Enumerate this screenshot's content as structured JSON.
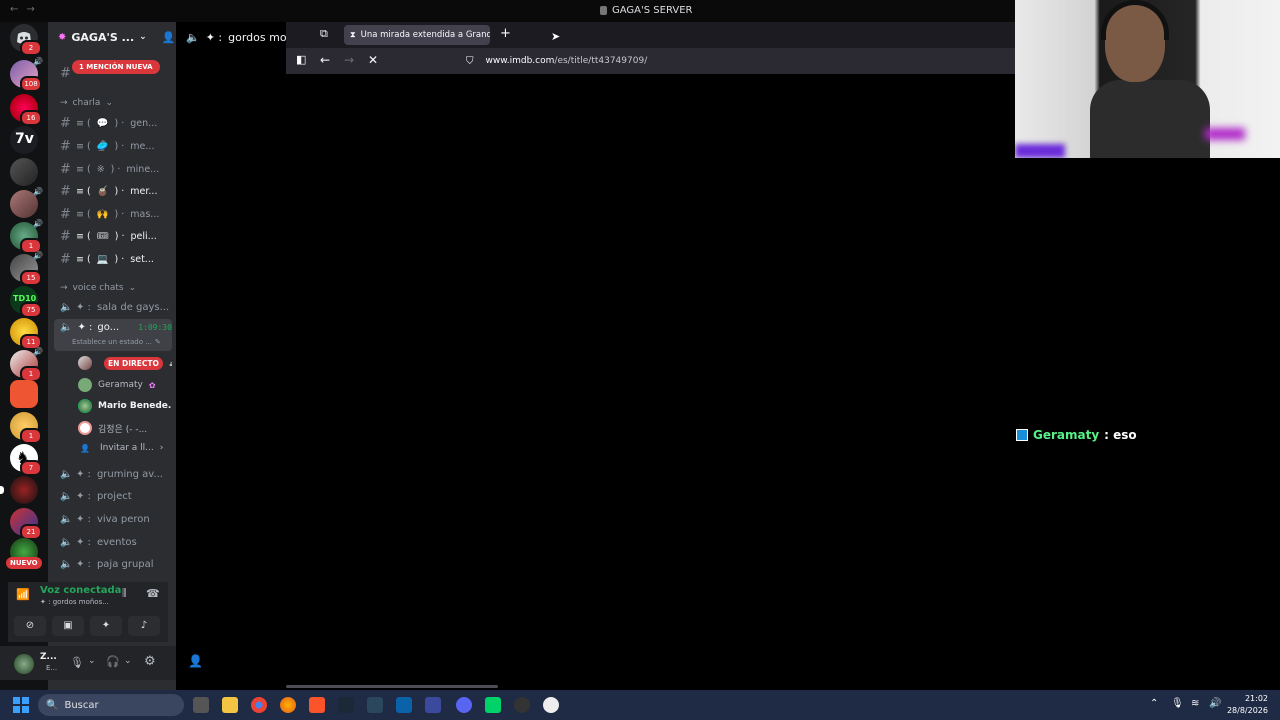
{
  "window": {
    "title": "GAGA'S SERVER"
  },
  "server": {
    "name": "GAGA'S ...",
    "mention_pill": "1 MENCIÓN NUEVA",
    "nuevo_label": "NUEVO",
    "badges": [
      "2",
      "108",
      "16",
      "1",
      "15",
      "75",
      "11",
      "1",
      "1",
      "7",
      "21"
    ]
  },
  "sidebar": {
    "cat_charla": "charla",
    "text_channels": [
      {
        "emoji": "💬",
        "name": "gen..."
      },
      {
        "emoji": "🥏",
        "name": "me..."
      },
      {
        "emoji": "※",
        "name": "mine..."
      },
      {
        "emoji": "🧉",
        "name": "mer..."
      },
      {
        "emoji": "🙌",
        "name": "mas..."
      },
      {
        "emoji": "🎟",
        "name": "peli..."
      },
      {
        "emoji": "💻",
        "name": "set..."
      }
    ],
    "cat_voice": "voice chats",
    "voice_channels": [
      {
        "name": "sala de gays..."
      },
      {
        "name": "go...",
        "timer": "1:09:30",
        "status": "Establece un estado ..."
      },
      {
        "name": "gruming av..."
      },
      {
        "name": "project"
      },
      {
        "name": "viva peron"
      },
      {
        "name": "eventos"
      },
      {
        "name": "paja grupal"
      }
    ],
    "members": {
      "live_badge": "EN DIRECTO",
      "m2": "Geramaty",
      "m3": "Mario Benede...",
      "m4": "김정은 (- -...",
      "invite": "Invitar a ll..."
    }
  },
  "voice_panel": {
    "status": "Voz conectada",
    "channel": "gordos moños..."
  },
  "userbar": {
    "name": "Z...",
    "sub": "E..."
  },
  "chat_header": {
    "channel": "gordos moños"
  },
  "browser": {
    "tab_title": "Una mirada extendida a Grand",
    "url_host": "www.imdb.com",
    "url_path": "/es/title/tt43749709/"
  },
  "overlay": {
    "user": "Geramaty",
    "message": ": eso"
  },
  "taskbar": {
    "search_label": "Buscar",
    "time": "21:02",
    "date": "28/8/2026"
  },
  "colors": {
    "discord_bg": "#2b2d31",
    "rail_bg": "#111214",
    "danger": "#da373c",
    "green": "#57f287",
    "firefox_tab": "#42414d"
  }
}
